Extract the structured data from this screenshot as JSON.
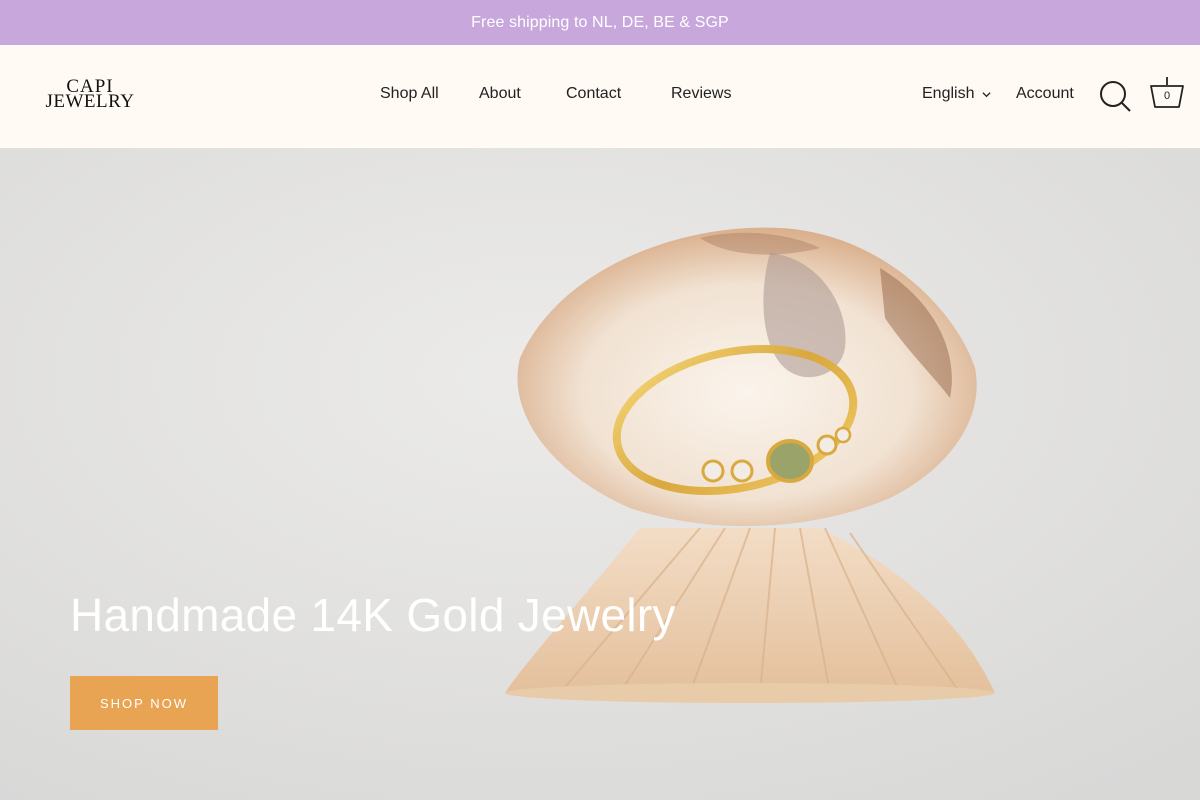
{
  "colors": {
    "announcement_bg": "#c8a8dc",
    "header_bg": "#fffaf3",
    "button_bg": "#e8a452",
    "hero_bg": "#e2e1df"
  },
  "announcement": {
    "text": "Free shipping to NL, DE, BE & SGP"
  },
  "logo": {
    "line1": "CAPI",
    "line2": "JEWELRY"
  },
  "nav": {
    "items": [
      {
        "label": "Shop All"
      },
      {
        "label": "About"
      },
      {
        "label": "Contact"
      },
      {
        "label": "Reviews"
      }
    ]
  },
  "header_actions": {
    "language": "English",
    "language_icon": "chevron-down-icon",
    "account": "Account",
    "search_icon": "search-icon",
    "cart_icon": "basket-icon",
    "cart_count": "0"
  },
  "hero": {
    "title": "Handmade 14K Gold Jewelry",
    "button_label": "SHOP NOW",
    "image_subject": "gold ring with gemstones resting on seashells"
  }
}
